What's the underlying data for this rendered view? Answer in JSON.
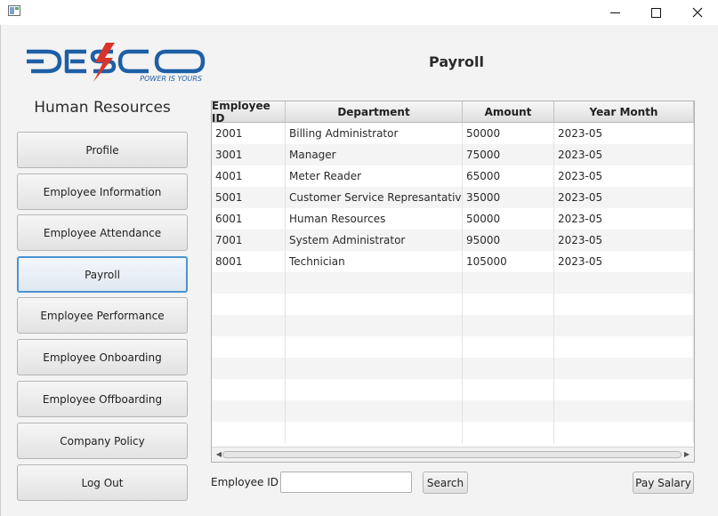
{
  "window": {
    "icons": {
      "app": "app-window-icon",
      "minimize": "minimize-icon",
      "maximize": "maximize-icon",
      "close": "close-icon"
    },
    "close_glyph": "✕"
  },
  "logo": {
    "brand": "DESCO",
    "tagline": "POWER IS YOURS",
    "colors": {
      "brand_blue": "#1e5fa6",
      "bolt_red": "#d9342b"
    }
  },
  "sidebar": {
    "heading": "Human Resources",
    "items": [
      {
        "label": "Profile",
        "active": false
      },
      {
        "label": "Employee Information",
        "active": false
      },
      {
        "label": "Employee Attendance",
        "active": false
      },
      {
        "label": "Payroll",
        "active": true
      },
      {
        "label": "Employee Performance",
        "active": false
      },
      {
        "label": "Employee Onboarding",
        "active": false
      },
      {
        "label": "Employee Offboarding",
        "active": false
      },
      {
        "label": "Company Policy",
        "active": false
      },
      {
        "label": "Log Out",
        "active": false
      }
    ]
  },
  "main": {
    "title": "Payroll",
    "table": {
      "columns": [
        "Employee ID",
        "Department",
        "Amount",
        "Year Month"
      ],
      "rows": [
        [
          "2001",
          "Billing Administrator",
          "50000",
          "2023-05"
        ],
        [
          "3001",
          "Manager",
          "75000",
          "2023-05"
        ],
        [
          "4001",
          "Meter Reader",
          "65000",
          "2023-05"
        ],
        [
          "5001",
          "Customer Service Represantative",
          "35000",
          "2023-05"
        ],
        [
          "6001",
          "Human Resources",
          "50000",
          "2023-05"
        ],
        [
          "7001",
          "System Administrator",
          "95000",
          "2023-05"
        ],
        [
          "8001",
          "Technician",
          "105000",
          "2023-05"
        ]
      ],
      "scroll_icons": {
        "left": "scroll-left-icon",
        "right": "scroll-right-icon"
      },
      "scroll_glyphs": {
        "left": "◀",
        "right": "▶"
      }
    },
    "search": {
      "label": "Employee ID",
      "value": "",
      "placeholder": "",
      "button_label": "Search"
    },
    "pay_button_label": "Pay Salary"
  },
  "colors": {
    "accent": "#4a93d3",
    "window_bg": "#f3f3f3"
  }
}
